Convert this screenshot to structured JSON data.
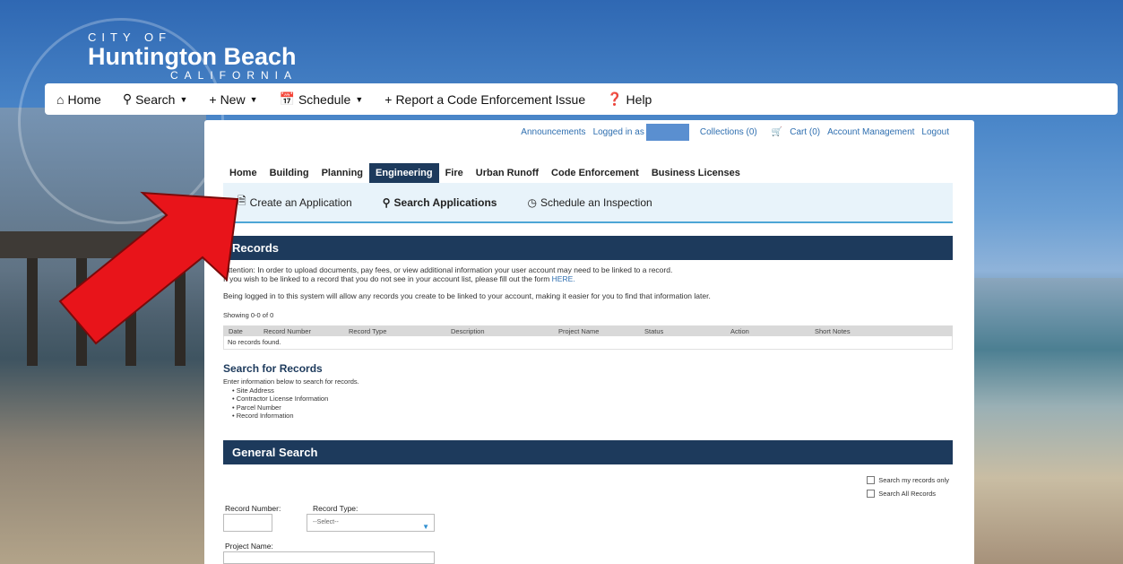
{
  "logo": {
    "city": "CITY OF",
    "name": "Huntington Beach",
    "state": "CALIFORNIA"
  },
  "topnav": {
    "items": [
      {
        "label": "Home",
        "icon": "home-icon",
        "caret": false
      },
      {
        "label": "Search",
        "icon": "search-icon",
        "caret": true
      },
      {
        "label": "New",
        "icon": "plus-icon",
        "caret": true
      },
      {
        "label": "Schedule",
        "icon": "calendar-icon",
        "caret": true
      },
      {
        "label": "Report a Code Enforcement Issue",
        "icon": "plus-icon",
        "caret": false
      },
      {
        "label": "Help",
        "icon": "help-icon",
        "caret": false
      }
    ]
  },
  "util": {
    "announcements": "Announcements",
    "logged_in": "Logged in as",
    "collections": "Collections (0)",
    "cart": "Cart (0)",
    "account": "Account Management",
    "logout": "Logout"
  },
  "module_tabs": [
    "Home",
    "Building",
    "Planning",
    "Engineering",
    "Fire",
    "Urban Runoff",
    "Code Enforcement",
    "Business Licenses"
  ],
  "active_tab": "Engineering",
  "subtabs": {
    "create": "Create an Application",
    "search": "Search Applications",
    "schedule": "Schedule an Inspection"
  },
  "records": {
    "title": "Records",
    "attention": "Attention: In order to upload documents, pay fees, or view additional information your user account may need to be linked to a record.",
    "link_line": "If you wish to be linked to a record that you do not see in your account list, please fill out the form",
    "link_text": "HERE.",
    "being_logged": "Being logged in to this system will allow any records you create to be linked to your account, making it easier for you to find that information later.",
    "showing": "Showing 0-0 of 0",
    "columns": [
      "Date",
      "Record Number",
      "Record Type",
      "Description",
      "Project Name",
      "Status",
      "Action",
      "Short Notes"
    ],
    "empty": "No records found."
  },
  "search_records": {
    "title": "Search for Records",
    "intro": "Enter information below to search for records.",
    "items": [
      "• Site Address",
      "• Contractor License Information",
      "• Parcel Number",
      "• Record Information"
    ]
  },
  "general_search": {
    "title": "General Search",
    "my_records": "Search my records only",
    "all_records": "Search All Records",
    "record_number_label": "Record Number:",
    "record_type_label": "Record Type:",
    "record_type_value": "--Select--",
    "project_name_label": "Project Name:"
  },
  "colors": {
    "navy": "#1d3a5c",
    "link": "#2f6fb0",
    "arrow": "#e8141a"
  }
}
